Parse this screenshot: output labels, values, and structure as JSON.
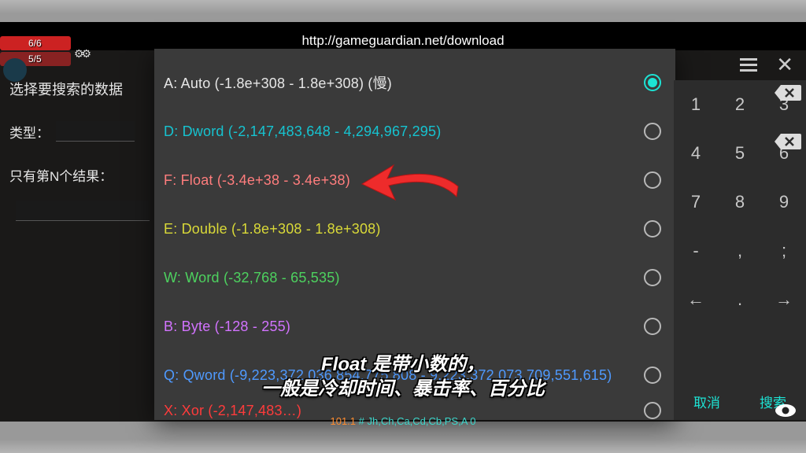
{
  "url": "http://gameguardian.net/download",
  "hp": {
    "line1": "6/6",
    "line2": "5/5"
  },
  "left": {
    "title": "选择要搜索的数据",
    "type_label": "类型：",
    "nth_label": "只有第N个结果："
  },
  "types": [
    {
      "label": "A: Auto (-1.8e+308 - 1.8e+308) (慢)",
      "colorClass": "c-white",
      "selected": true
    },
    {
      "label": "D: Dword (-2,147,483,648 - 4,294,967,295)",
      "colorClass": "c-cyan",
      "selected": false
    },
    {
      "label": "F: Float (-3.4e+38 - 3.4e+38)",
      "colorClass": "c-pink",
      "selected": false
    },
    {
      "label": "E: Double (-1.8e+308 - 1.8e+308)",
      "colorClass": "c-yellow",
      "selected": false
    },
    {
      "label": "W: Word (-32,768 - 65,535)",
      "colorClass": "c-green",
      "selected": false
    },
    {
      "label": "B: Byte (-128 - 255)",
      "colorClass": "c-purple",
      "selected": false
    },
    {
      "label": "Q: Qword (-9,223,372,036,854,775,808 - 9,223,372,073,709,551,615)",
      "colorClass": "c-lblue",
      "selected": false
    },
    {
      "label": "X: Xor (-2,147,483…)",
      "colorClass": "c-red",
      "selected": false
    }
  ],
  "keypad": {
    "rows": [
      [
        "1",
        "2",
        "3",
        "bksp"
      ],
      [
        "4",
        "5",
        "6",
        "bksp"
      ],
      [
        "7",
        "8",
        "9",
        ""
      ],
      [
        "-",
        ",",
        ";",
        ""
      ],
      [
        "left",
        ".",
        "right",
        ""
      ]
    ]
  },
  "buttons": {
    "cancel": "取消",
    "search": "搜索"
  },
  "subtitle": {
    "l1": "Float 是带小数的，",
    "l2": "一般是冷却时间、暴击率、百分比"
  },
  "status": {
    "left": "101.1",
    "right": " # Jh,Ch,Ca,Cd,Cb,PS,A 0"
  }
}
